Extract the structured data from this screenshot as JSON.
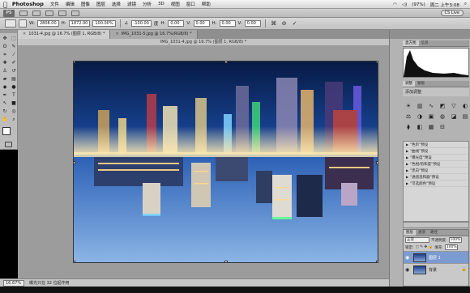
{
  "menubar": {
    "app_name": "Photoshop",
    "items": [
      "文件",
      "编辑",
      "图像",
      "图层",
      "选择",
      "滤镜",
      "分析",
      "3D",
      "视图",
      "窗口",
      "帮助"
    ],
    "battery": "(97%)",
    "clock": "周二 上午3:08"
  },
  "appbar": {
    "logo": "PS",
    "cs_live": "CS Live"
  },
  "options": {
    "w_label": "W:",
    "w_value": "2808.00",
    "h_label": "H:",
    "h_value": "1872.00",
    "scale_pct": "100.00%",
    "angle_value": "-100.00",
    "angle_unit": "度",
    "skew_h_label": "H:",
    "skew_h_value": "0.00",
    "skew_v_label": "V:",
    "skew_v_value": "0.00",
    "h2_label": "H:",
    "h2_value": "0.00",
    "v2_label": "V:",
    "v2_value": "0.00",
    "cancel_symbol": "⊘",
    "commit_symbol": "✓"
  },
  "doc_tabs": [
    {
      "label": "1031-4.jpg @ 16.7% (图层 1, RGB/8) *",
      "active": true
    },
    {
      "label": "IMG_1031-5.jpg @ 16.7%(RGB/8) *",
      "active": false
    }
  ],
  "doc_title": "IMG_1031-4.jpg @ 16.7% (图层 1, RGB/8) *",
  "status": {
    "zoom": "16.67%",
    "info": "曝光只在 32 位起作用"
  },
  "panels": {
    "top_tabs": [
      "直方图",
      "信息"
    ],
    "adjust_tabs": [
      "调整",
      "蒙版"
    ],
    "adjust_title": "添加调整",
    "adjust_icons": [
      "☀",
      "▥",
      "∿",
      "◩",
      "▽",
      "◐",
      "⚖",
      "◑",
      "▣",
      "◍",
      "◪",
      "▤",
      "⧫",
      "◧",
      "▦",
      "⊟"
    ],
    "presets": [
      "\"色阶\"预设",
      "\"曲线\"预设",
      "\"曝光度\"预设",
      "\"色相/饱和度\"预设",
      "\"黑白\"预设",
      "\"通道混和器\"预设",
      "\"可选颜色\"预设"
    ],
    "layers_tabs": [
      "图层",
      "通道",
      "路径"
    ],
    "blend_mode": "正常",
    "opacity_label": "不透明度:",
    "opacity": "100%",
    "lock_label": "锁定:",
    "fill_label": "填充:",
    "fill": "100%",
    "layers": [
      {
        "name": "图层 1",
        "active": true
      },
      {
        "name": "背景",
        "active": false
      }
    ]
  }
}
